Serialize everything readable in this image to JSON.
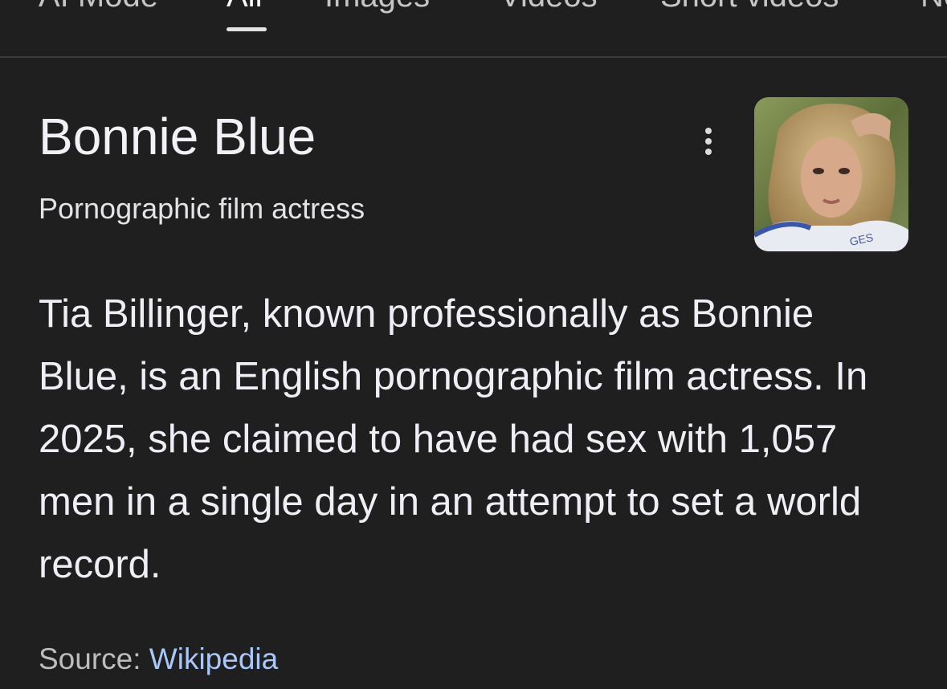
{
  "tabs": [
    {
      "label": "AI Mode"
    },
    {
      "label": "All",
      "active": true
    },
    {
      "label": "Images"
    },
    {
      "label": "Videos"
    },
    {
      "label": "Short videos"
    },
    {
      "label": "News"
    }
  ],
  "knowledge_panel": {
    "title": "Bonnie Blue",
    "subtitle": "Pornographic film actress",
    "more_icon": "more-vert-icon",
    "image_caption": "GES",
    "description": "Tia Billinger, known professionally as Bonnie Blue, is an English pornographic film actress. In 2025, she claimed to have had sex with 1,057 men in a single day in an attempt to set a world record.",
    "source_label": "Source: ",
    "source_link": "Wikipedia"
  },
  "colors": {
    "background": "#1f1f1f",
    "link": "#a8c7fa",
    "divider": "#3c3c3c"
  }
}
